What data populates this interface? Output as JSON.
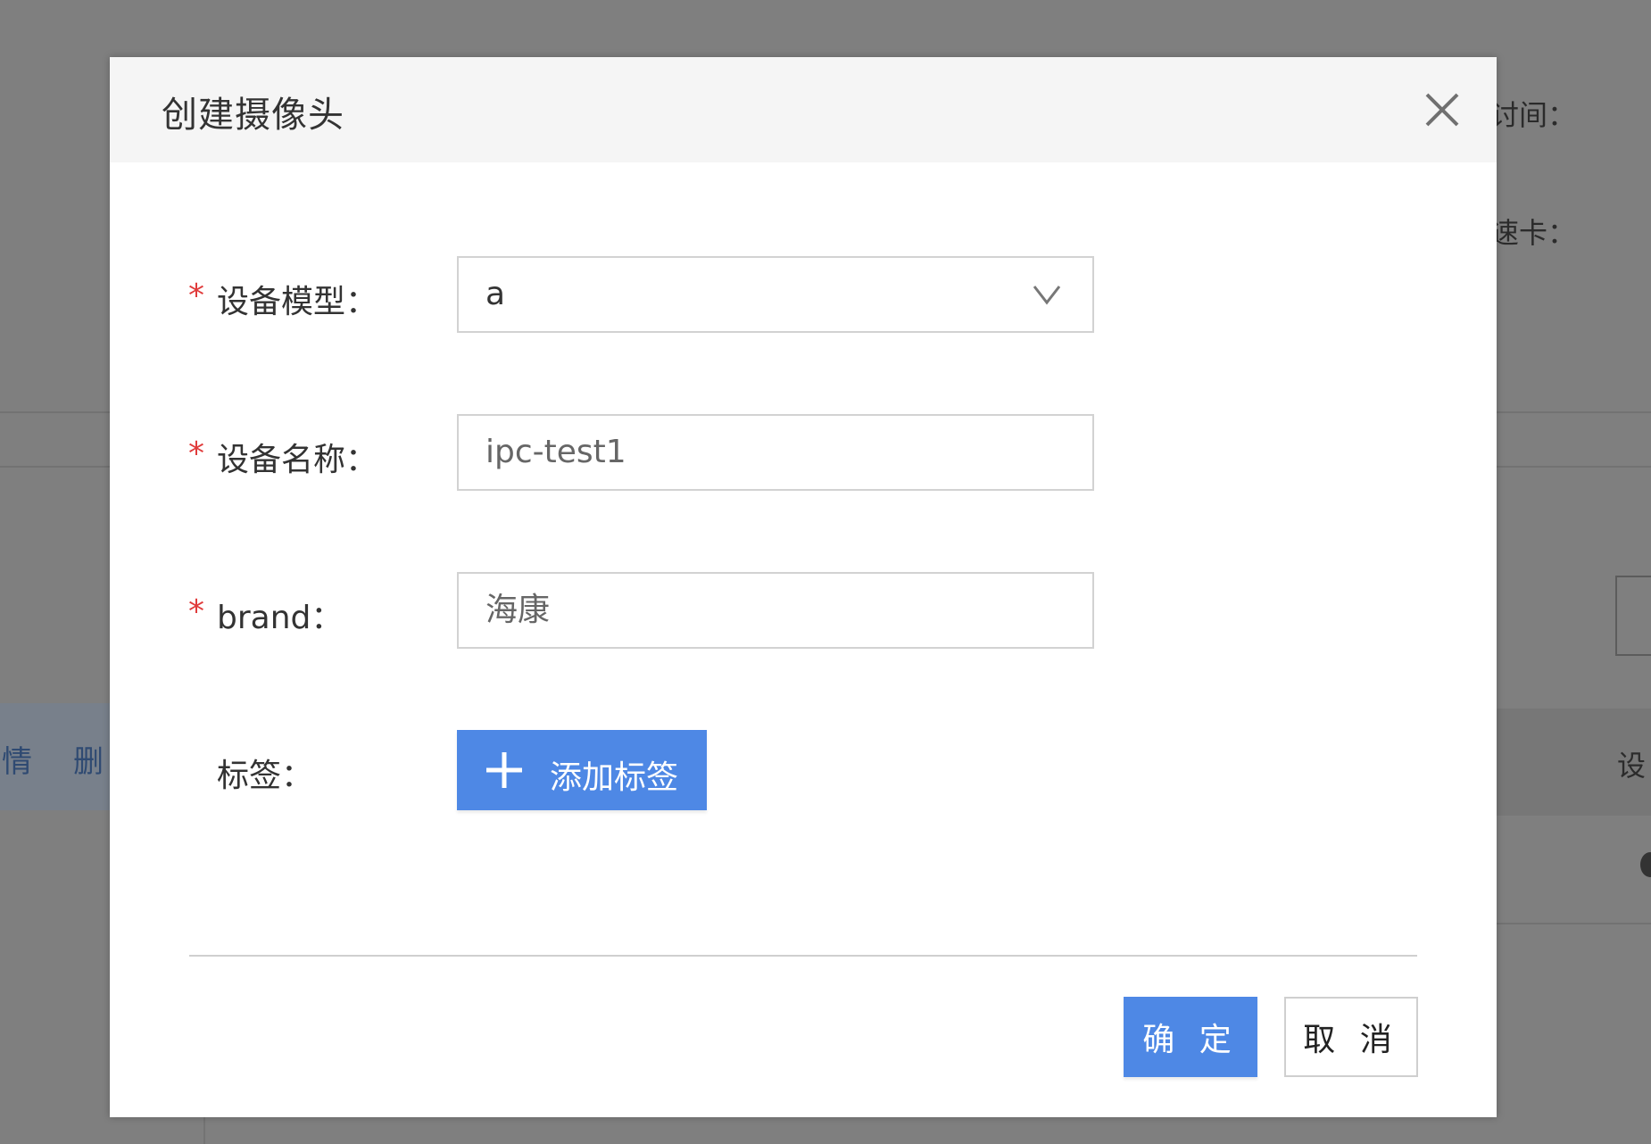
{
  "background": {
    "fragment_time_label": "讨间：",
    "fragment_card_label": "速卡：",
    "fragment_details_link": "情",
    "fragment_delete_link": "删",
    "fragment_column_label": "设"
  },
  "dialog": {
    "title": "创建摄像头",
    "close_icon": "close-icon",
    "fields": {
      "device_model": {
        "label": "设备模型：",
        "required_mark": "*",
        "value": "a"
      },
      "device_name": {
        "label": "设备名称：",
        "required_mark": "*",
        "value": "ipc-test1"
      },
      "brand": {
        "label": "brand：",
        "required_mark": "*",
        "value": "海康"
      },
      "tags": {
        "label": "标签：",
        "add_button_label": "添加标签"
      }
    },
    "footer": {
      "confirm_label": "确 定",
      "cancel_label": "取 消"
    },
    "colors": {
      "primary": "#4e88e5",
      "required": "#e03b3b",
      "overlay": "#7f7f7f"
    }
  }
}
